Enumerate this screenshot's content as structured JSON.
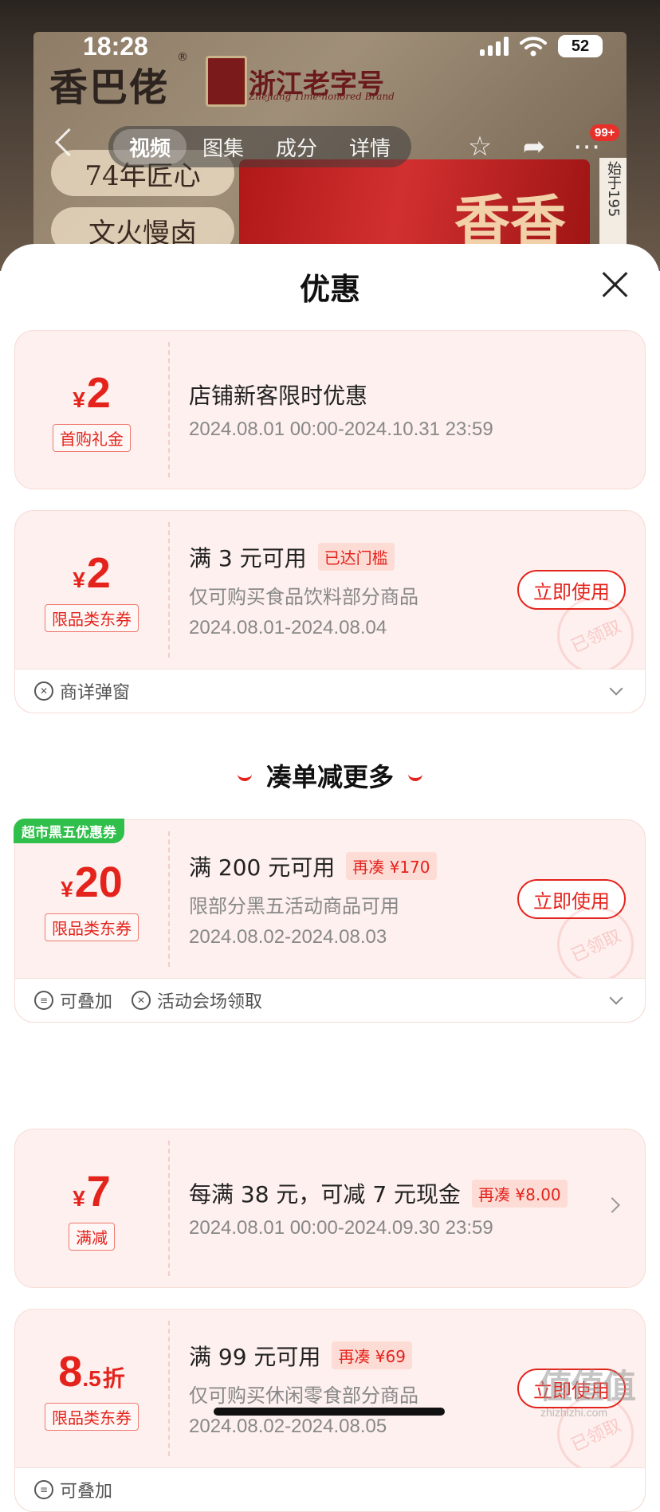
{
  "status_bar": {
    "time": "18:28",
    "battery": "52"
  },
  "background": {
    "brand": "香巴佬",
    "brand_tm": "®",
    "zhejiang_label": "浙江老字号",
    "zhejiang_en": "Zhejiang Time-honored Brand",
    "slogans": [
      "74年匠心",
      "文火慢卤"
    ],
    "package_text": "香香",
    "side_text": "始于195",
    "badge": "99+"
  },
  "nav": {
    "tabs": [
      "视频",
      "图集",
      "成分",
      "详情"
    ],
    "active_tab": "视频"
  },
  "sheet": {
    "title": "优惠",
    "section_title": "凑单减更多"
  },
  "coupons": [
    {
      "yen": "¥",
      "amount": "2",
      "tag": "首购礼金",
      "title": "店铺新客限时优惠",
      "date": "2024.08.01 00:00-2024.10.31 23:59"
    },
    {
      "yen": "¥",
      "amount": "2",
      "tag": "限品类东券",
      "title": "满 3 元可用",
      "pill": "已达门槛",
      "sub": "仅可购买食品饮料部分商品",
      "date": "2024.08.01-2024.08.04",
      "button": "立即使用",
      "stamp": "已领取",
      "footer": [
        "商详弹窗"
      ]
    },
    {
      "corner": "超市黑五优惠券",
      "yen": "¥",
      "amount": "20",
      "tag": "限品类东券",
      "title": "满 200 元可用",
      "pill": "再凑 ¥170",
      "sub": "限部分黑五活动商品可用",
      "date": "2024.08.02-2024.08.03",
      "button": "立即使用",
      "stamp": "已领取",
      "footer": [
        "可叠加",
        "活动会场领取"
      ]
    },
    {
      "yen": "¥",
      "amount": "7",
      "tag": "满减",
      "title": "每满 38 元，可减 7 元现金",
      "pill": "再凑 ¥8.00",
      "date": "2024.08.01 00:00-2024.09.30 23:59"
    },
    {
      "amount": "8",
      "amount_dec": ".5",
      "unit": "折",
      "tag": "限品类东券",
      "title": "满 99 元可用",
      "pill": "再凑 ¥69",
      "sub": "仅可购买休闲零食部分商品",
      "date": "2024.08.02-2024.08.05",
      "button": "立即使用",
      "stamp": "已领取",
      "footer": [
        "可叠加"
      ]
    }
  ],
  "watermark": {
    "main": "值值值",
    "sub": "zhizhizhi.com"
  }
}
